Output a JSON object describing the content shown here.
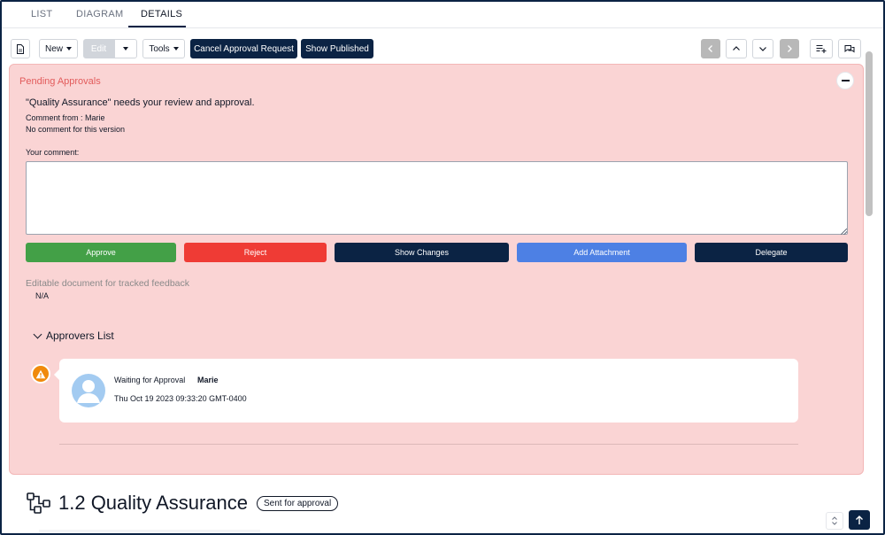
{
  "tabs": [
    {
      "label": "LIST"
    },
    {
      "label": "DIAGRAM"
    },
    {
      "label": "DETAILS",
      "active": true
    }
  ],
  "toolbar": {
    "new_label": "New",
    "edit_label": "Edit",
    "tools_label": "Tools",
    "cancel_approval_label": "Cancel Approval Request",
    "show_published_label": "Show Published",
    "icons": [
      "document-icon",
      "chevron-left-icon",
      "chevron-up-icon",
      "chevron-down-icon",
      "chevron-right-icon",
      "playlist-add-icon",
      "comments-icon"
    ]
  },
  "pending": {
    "title": "Pending Approvals",
    "message": "\"Quality Assurance\" needs your review and approval.",
    "comment_from": "Comment from : Marie",
    "no_comment": "No comment for this version",
    "your_comment_label": "Your comment:",
    "comment_value": "",
    "buttons": {
      "approve": "Approve",
      "reject": "Reject",
      "show_changes": "Show Changes",
      "add_attachment": "Add Attachment",
      "delegate": "Delegate"
    },
    "editable_label": "Editable document for tracked feedback",
    "editable_value": "N/A",
    "approvers_list_label": "Approvers List",
    "approvers": [
      {
        "status": "Waiting for Approval",
        "name": "Marie",
        "date": "Thu Oct 19 2023 09:33:20 GMT-0400"
      }
    ]
  },
  "document": {
    "title": "1.2 Quality Assurance",
    "status_badge": "Sent for approval"
  },
  "colors": {
    "navy": "#0b2344",
    "approve": "#43a047",
    "reject": "#ef3b35",
    "attachment": "#4d80e4",
    "panel_bg": "#fad4d4",
    "panel_title": "#e25b5b",
    "warning": "#f08a0c"
  }
}
